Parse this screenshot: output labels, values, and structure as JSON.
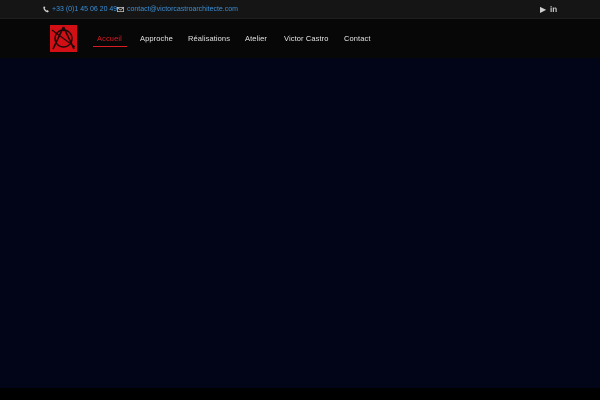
{
  "topbar": {
    "phone": "+33 (0)1 45 06 20 49",
    "email": "contact@victorcastroarchitecte.com",
    "social": [
      {
        "icon": "youtube-play-icon",
        "label": "▶"
      },
      {
        "icon": "linkedin-icon",
        "label": "in"
      }
    ]
  },
  "nav": {
    "items": [
      {
        "label": "Accueil",
        "active": true
      },
      {
        "label": "Approche",
        "active": false
      },
      {
        "label": "Réalisations",
        "active": false
      },
      {
        "label": "Atelier",
        "active": false
      },
      {
        "label": "Victor Castro",
        "active": false
      },
      {
        "label": "Contact",
        "active": false
      }
    ]
  },
  "colors": {
    "accent": "#d91b22",
    "link": "#3c8fd6",
    "hero_background": "#020418",
    "topbar_background": "#151515"
  }
}
